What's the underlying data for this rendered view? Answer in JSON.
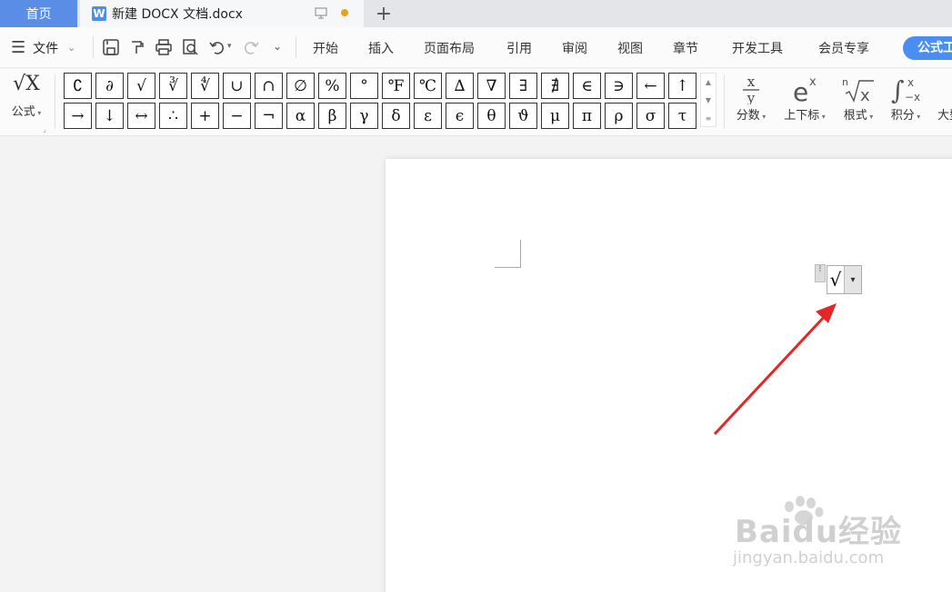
{
  "tabs": {
    "home": "首页",
    "doc_icon": "W",
    "doc_title": "新建 DOCX 文档.docx",
    "add": "+"
  },
  "menu": {
    "file": "文件",
    "items": [
      "开始",
      "插入",
      "页面布局",
      "引用",
      "审阅",
      "视图",
      "章节",
      "开发工具",
      "会员专享"
    ],
    "formula_tools": "公式工"
  },
  "toolbar": {
    "formula_label": "公式",
    "formula_icon": "√X",
    "symbols_row1": [
      "∁",
      "∂",
      "√",
      "∛",
      "∜",
      "∪",
      "∩",
      "∅",
      "%",
      "°",
      "℉",
      "℃",
      "∆",
      "∇",
      "∃",
      "∄",
      "∈",
      "∋",
      "←",
      "↑"
    ],
    "symbols_row2": [
      "→",
      "↓",
      "↔",
      "∴",
      "+",
      "−",
      "¬",
      "α",
      "β",
      "γ",
      "δ",
      "ε",
      "ϵ",
      "θ",
      "ϑ",
      "μ",
      "π",
      "ρ",
      "σ",
      "τ"
    ],
    "tools": [
      {
        "label": "分数",
        "icon": "x/y"
      },
      {
        "label": "上下标",
        "icon": "eˣ"
      },
      {
        "label": "根式",
        "icon": "ⁿ√x"
      },
      {
        "label": "积分",
        "icon": "∫"
      },
      {
        "label": "大型",
        "icon": ""
      }
    ]
  },
  "equation": {
    "content": "√",
    "dropdown": "▾"
  },
  "watermark": {
    "line1": "Baidu经验",
    "line2": "jingyan.baidu.com"
  },
  "colors": {
    "accent": "#4a8ef2",
    "home_tab": "#5a8de6",
    "arrow": "#e62626"
  }
}
